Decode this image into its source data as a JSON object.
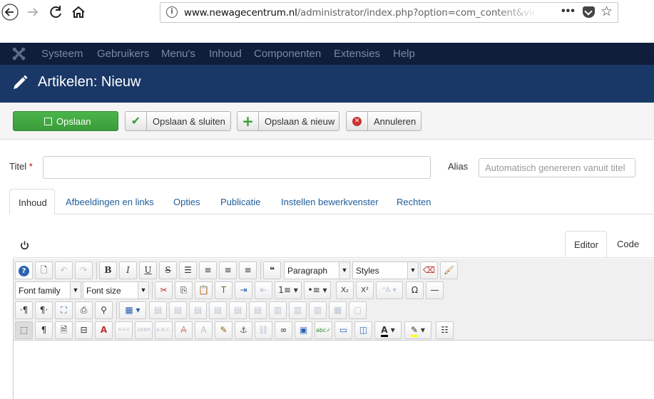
{
  "browser": {
    "url_host": "www.newagecentrum.nl",
    "url_path": "/administrator/index.php?option=com_content&view=ar",
    "back_icon": "arrow-left-icon",
    "forward_icon": "arrow-right-icon",
    "reload_icon": "reload-icon",
    "home_icon": "home-icon"
  },
  "topnav": {
    "items": [
      {
        "label": "Systeem"
      },
      {
        "label": "Gebruikers"
      },
      {
        "label": "Menu's"
      },
      {
        "label": "Inhoud"
      },
      {
        "label": "Componenten"
      },
      {
        "label": "Extensies"
      },
      {
        "label": "Help"
      }
    ]
  },
  "page": {
    "title": "Artikelen: Nieuw"
  },
  "toolbar": {
    "save": "Opslaan",
    "save_close": "Opslaan & sluiten",
    "save_new": "Opslaan & nieuw",
    "cancel": "Annuleren"
  },
  "form": {
    "title_label": "Titel",
    "required_mark": "*",
    "title_value": "",
    "alias_label": "Alias",
    "alias_placeholder": "Automatisch genereren vanuit titel"
  },
  "tabs": [
    {
      "label": "Inhoud",
      "active": true
    },
    {
      "label": "Afbeeldingen en links"
    },
    {
      "label": "Opties"
    },
    {
      "label": "Publicatie"
    },
    {
      "label": "Instellen bewerkvenster"
    },
    {
      "label": "Rechten"
    }
  ],
  "editor": {
    "tabs": [
      {
        "label": "Editor",
        "active": true
      },
      {
        "label": "Code"
      }
    ],
    "format_select": "Paragraph",
    "styles_select": "Styles",
    "font_family_select": "Font family",
    "font_size_select": "Font size"
  },
  "colors": {
    "topnav_bg": "#0f1e3b",
    "title_bg": "#1a3867",
    "save_green": "#3f9f3f",
    "link_blue": "#1f5d99"
  }
}
